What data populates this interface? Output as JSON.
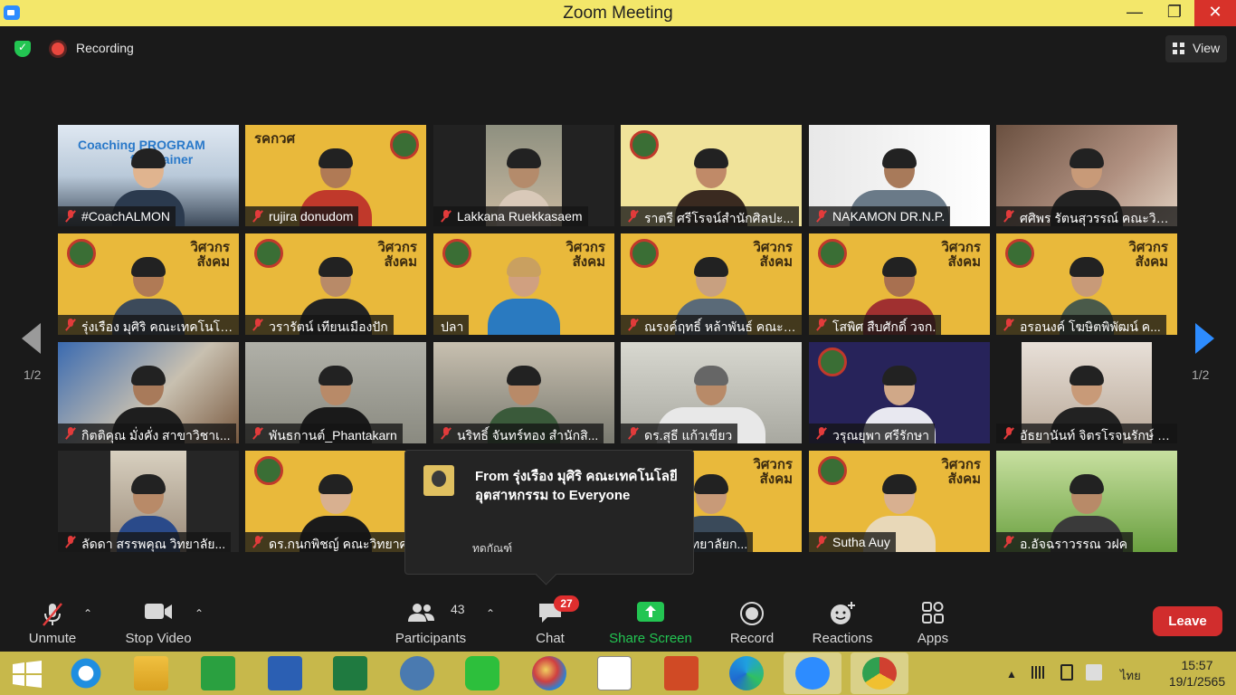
{
  "window": {
    "title": "Zoom Meeting",
    "minimize": "—",
    "maximize": "❐",
    "close": "✕"
  },
  "status": {
    "recording": "Recording",
    "view": "View"
  },
  "pager": {
    "left": "1/2",
    "right": "1/2"
  },
  "participants": [
    {
      "name": "#CoachALMON"
    },
    {
      "name": "rujira donudom"
    },
    {
      "name": "Lakkana Ruekkasaem"
    },
    {
      "name": "ราตรี  ศรีโรจน์สำนักศิลปะ..."
    },
    {
      "name": "NAKAMON DR.N.P."
    },
    {
      "name": "ศศิพร รัตนสุวรรณ์ คณะวิท..."
    },
    {
      "name": "รุ่งเรือง มุศิริ คณะเทคโนโลย..."
    },
    {
      "name": "วรารัตน์ เทียนเมืองปัก"
    },
    {
      "name": "ปลา"
    },
    {
      "name": "ณรงค์ฤทธิ์ หล้าพันธ์ คณะว..."
    },
    {
      "name": "โสพิศ สืบศักดิ์ วจก."
    },
    {
      "name": "อรอนงค์ โฆษิตพิพัฒน์ ค..."
    },
    {
      "name": "กิตติคุณ  มั่งคั่ง สาขาวิชาเ..."
    },
    {
      "name": "พันธกานต์_Phantakarn"
    },
    {
      "name": "นริทธิ์ จันทร์ทอง สำนักสิ..."
    },
    {
      "name": "ดร.สุธี  แก้วเขียว"
    },
    {
      "name": "วรุณยุพา ศรีรักษา"
    },
    {
      "name": "อัธยานันท์ จิตรโรจนรักษ์ ค..."
    },
    {
      "name": "ลัดดา สรรพคุณ  วิทยาลัย..."
    },
    {
      "name": "ดร.กนกพิชญ์ คณะวิทยาศ..."
    },
    {
      "name": ""
    },
    {
      "name": "เจษฎ์ - วิทยาลัยก..."
    },
    {
      "name": "Sutha Auy"
    },
    {
      "name": "อ.อัจฉราวรรณ วฝค"
    }
  ],
  "tile_text": {
    "coaching": "Coaching PROGRAM",
    "coaching2": "for Trainer",
    "brand1": "วิศวกร",
    "brand2": "สังคม",
    "brand_flip": "รคกวศ"
  },
  "chat": {
    "from": "From รุ่งเรือง มุศิริ คณะเทคโนโลยีอุตสาหกรรม to Everyone",
    "message": "ทดกัณฑ์"
  },
  "toolbar": {
    "unmute": "Unmute",
    "stop_video": "Stop Video",
    "participants": "Participants",
    "participants_count": "43",
    "chat": "Chat",
    "chat_badge": "27",
    "share_screen": "Share Screen",
    "record": "Record",
    "reactions": "Reactions",
    "apps": "Apps",
    "leave": "Leave"
  },
  "taskbar": {
    "lang": "ไทย",
    "time": "15:57",
    "date": "19/1/2565"
  },
  "colors": {
    "accent": "#2d8cff",
    "titlebar": "#f3e76a",
    "leave": "#d12d2d",
    "share": "#23c552",
    "taskbar": "#c7b84b"
  }
}
